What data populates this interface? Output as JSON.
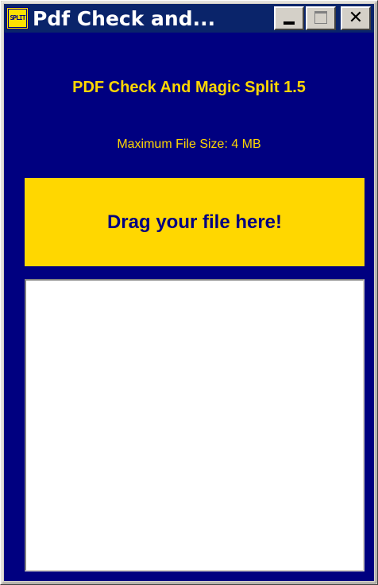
{
  "window": {
    "title": "Pdf Check and...",
    "icon": "split-app-icon",
    "icon_text": "SPLIT",
    "buttons": {
      "minimize": "minimize-icon",
      "maximize": "maximize-icon",
      "close": "close-icon",
      "close_glyph": "✕"
    }
  },
  "app": {
    "heading": "PDF Check And Magic Split 1.5",
    "max_file_size": "Maximum File Size: 4 MB",
    "drop_zone_label": "Drag your file here!"
  },
  "colors": {
    "title_bar": "#0a246a",
    "background": "#000080",
    "accent": "#ffd700",
    "text_on_accent": "#000080"
  }
}
